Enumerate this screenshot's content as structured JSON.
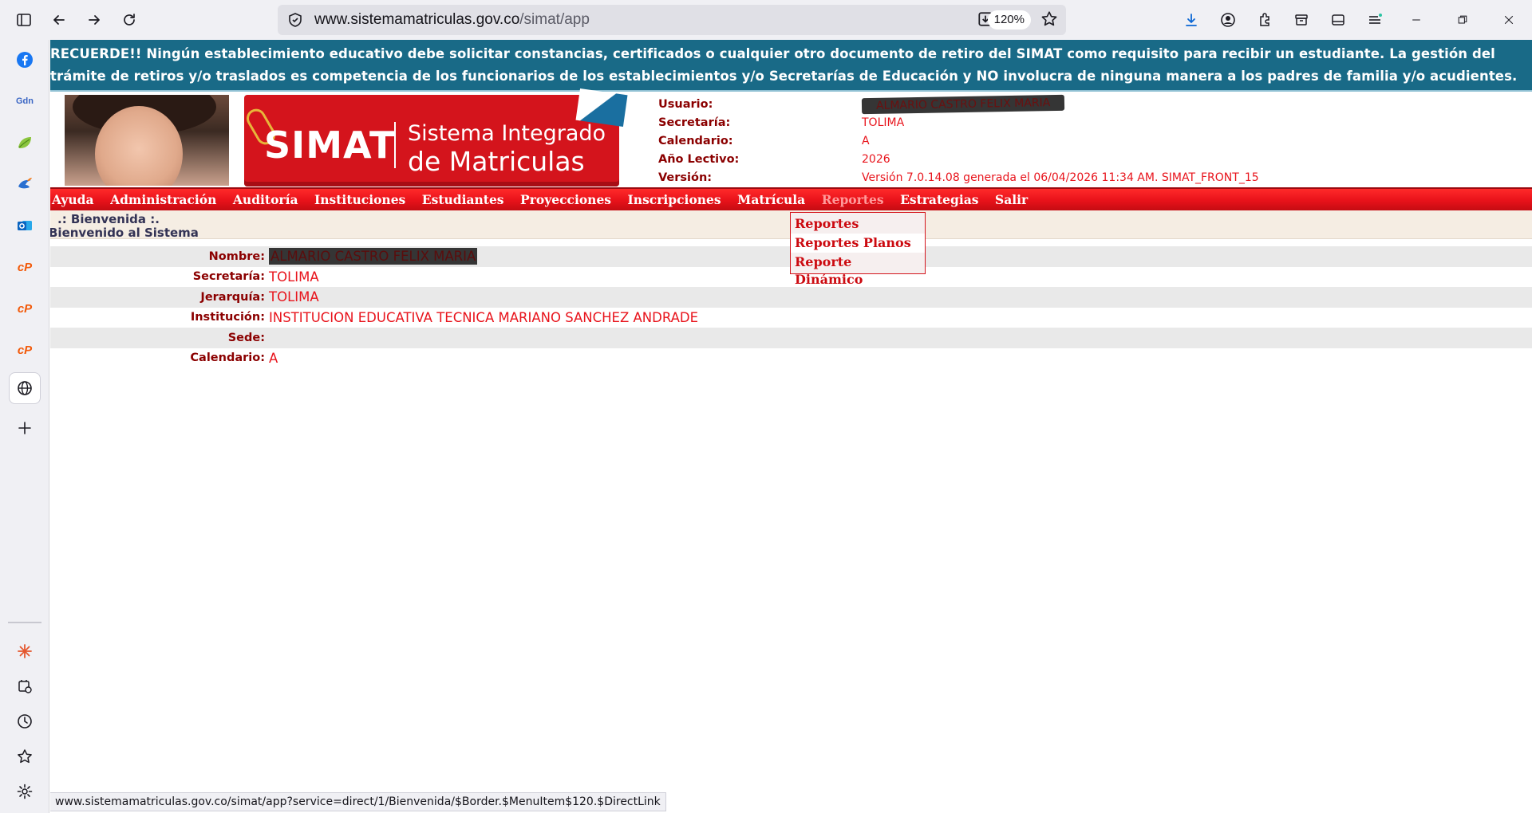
{
  "browser": {
    "url_host": "www.sistemamatriculas.gov.co",
    "url_path": "/simat/app",
    "zoom": "120%",
    "status_url": "www.sistemamatriculas.gov.co/simat/app?service=direct/1/Bienvenida/$Border.$MenuItem$120.$DirectLink"
  },
  "sidebar": {
    "items": [
      {
        "icon": "facebook-icon",
        "glyph": "f",
        "color": "#1877f2"
      },
      {
        "icon": "gdn-icon",
        "glyph": "Gdn",
        "color": "#3a66c4"
      },
      {
        "icon": "leaf-icon",
        "glyph": "",
        "color": "#7ab32e"
      },
      {
        "icon": "bird-icon",
        "glyph": "",
        "color": "#f27a1a"
      },
      {
        "icon": "outlook-icon",
        "glyph": "o",
        "color": "#0a64c0"
      },
      {
        "icon": "cp-icon",
        "glyph": "cP",
        "color": "#f25a0a"
      },
      {
        "icon": "cp-icon-2",
        "glyph": "cP",
        "color": "#f25a0a"
      },
      {
        "icon": "cp-icon-3",
        "glyph": "cP",
        "color": "#f25a0a"
      }
    ]
  },
  "banner": {
    "text": "RECUERDE!! Ningún establecimiento educativo debe solicitar constancias, certificados o cualquier otro documento de retiro del SIMAT como requisito para recibir un estudiante. La gestión del trámite de retiros y/o traslados es competencia de los funcionarios de los establecimientos y/o Secretarías de Educación y NO involucra de ninguna manera a los padres de familia y/o acudientes."
  },
  "logo": {
    "simat": "SIMAT",
    "line1": "Sistema Integrado",
    "line2": "de Matriculas"
  },
  "user_info": {
    "rows": [
      {
        "label": "Usuario:",
        "value": "ALMARIO CASTRO FELIX MARIA"
      },
      {
        "label": "Secretaría:",
        "value": "TOLIMA"
      },
      {
        "label": "Calendario:",
        "value": "A"
      },
      {
        "label": "Año Lectivo:",
        "value": "2026"
      },
      {
        "label": "Versión:",
        "value": "Versión 7.0.14.08 generada el 06/04/2026 11:34 AM. SIMAT_FRONT_15"
      }
    ]
  },
  "menu": {
    "items": [
      "Ayuda",
      "Administración",
      "Auditoría",
      "Instituciones",
      "Estudiantes",
      "Proyecciones",
      "Inscripciones",
      "Matrícula",
      "Reportes",
      "Estrategias",
      "Salir"
    ],
    "active": "Reportes",
    "dropdown": [
      "Reportes",
      "Reportes Planos",
      "Reporte Dinámico"
    ]
  },
  "welcome": {
    "title": ".: Bienvenida :.",
    "subtitle": "Bienvenido al Sistema"
  },
  "details": [
    {
      "label": "Nombre:",
      "value": "ALMARIO CASTRO FELIX MARIA"
    },
    {
      "label": "Secretaría:",
      "value": "TOLIMA"
    },
    {
      "label": "Jerarquía:",
      "value": "TOLIMA"
    },
    {
      "label": "Institución:",
      "value": "INSTITUCION EDUCATIVA TECNICA MARIANO SANCHEZ ANDRADE"
    },
    {
      "label": "Sede:",
      "value": ""
    },
    {
      "label": "Calendario:",
      "value": "A"
    }
  ]
}
